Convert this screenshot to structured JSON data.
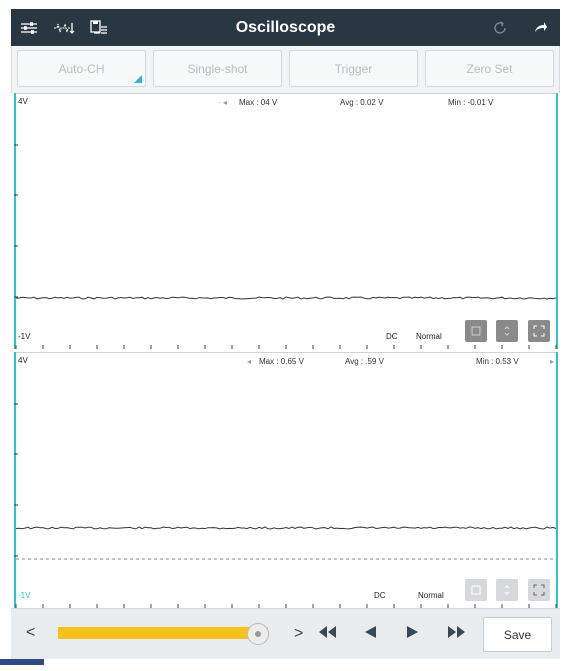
{
  "header": {
    "title": "Oscilloscope",
    "left_icons": [
      "settings-sliders-icon",
      "waveform-icon",
      "save-list-icon"
    ],
    "right_icons": [
      "refresh-icon",
      "back-icon"
    ]
  },
  "controls": {
    "auto_ch": "Auto-CH",
    "single_shot": "Single-shot",
    "trigger": "Trigger",
    "zero_set": "Zero Set"
  },
  "channels": [
    {
      "y_max": "4V",
      "y_min": "-1V",
      "max": "Max : 04 V",
      "avg": "Avg : 0.02 V",
      "min": "Min : -0.01 V",
      "coupling": "DC",
      "mode": "Normal"
    },
    {
      "y_max": "4V",
      "y_min": "-1V",
      "max": "Max : 0.65 V",
      "avg": "Avg : .59 V",
      "min": "Min : 0.53 V",
      "coupling": "DC",
      "mode": "Normal"
    }
  ],
  "bottom": {
    "prev": "<",
    "next": ">",
    "save_label": "Save",
    "slider_value": 0.95
  },
  "colors": {
    "titlebar": "#283742",
    "accent": "#2ec1d9",
    "slider": "#f5c21b"
  }
}
